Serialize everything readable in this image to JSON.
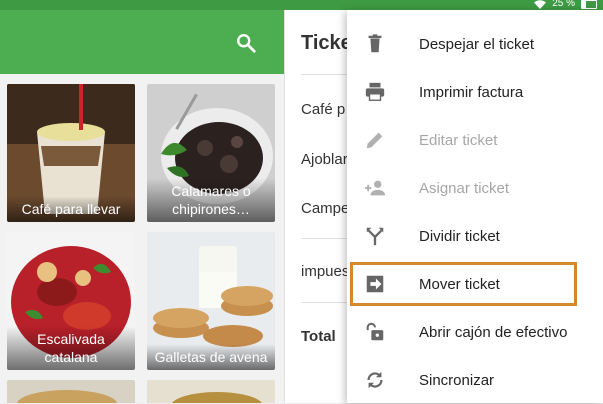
{
  "status_bar": {
    "battery": "25 %"
  },
  "ticket": {
    "title": "Ticke",
    "lines": [
      "Café p",
      "Ajoblar",
      "Campe",
      "impues"
    ],
    "total_label": "Total"
  },
  "products": [
    {
      "name": "Café para llevar"
    },
    {
      "name": "Calamares o chipirones…"
    },
    {
      "name": "Escalivada catalana"
    },
    {
      "name": "Galletas de avena"
    }
  ],
  "menu": {
    "items": [
      {
        "label": "Despejar el ticket",
        "icon": "trash-icon",
        "enabled": true
      },
      {
        "label": "Imprimir factura",
        "icon": "print-icon",
        "enabled": true
      },
      {
        "label": "Editar ticket",
        "icon": "pencil-icon",
        "enabled": false
      },
      {
        "label": "Asignar ticket",
        "icon": "person-add-icon",
        "enabled": false
      },
      {
        "label": "Dividir ticket",
        "icon": "split-icon",
        "enabled": true
      },
      {
        "label": "Mover ticket",
        "icon": "move-icon",
        "enabled": true
      },
      {
        "label": "Abrir cajón de efectivo",
        "icon": "unlock-icon",
        "enabled": true
      },
      {
        "label": "Sincronizar",
        "icon": "sync-icon",
        "enabled": true
      }
    ]
  },
  "colors": {
    "status_bar": "#3e9a43",
    "toolbar": "#4cae50",
    "highlight": "#d3892c",
    "icon": "#666666",
    "icon_disabled": "#b0b0b0"
  }
}
